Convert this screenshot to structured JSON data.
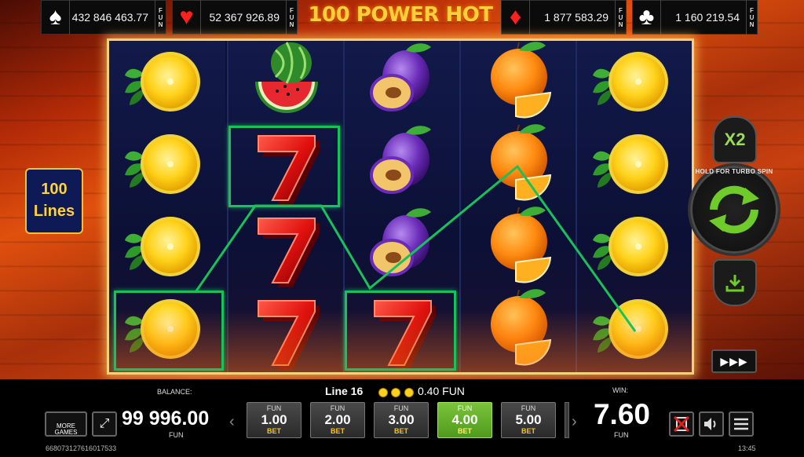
{
  "jackpots": [
    {
      "suit": "spade-icon",
      "glyph": "♠",
      "amount": "432 846 463.77",
      "fun": "FUN",
      "color": "#ffffff"
    },
    {
      "suit": "heart-icon",
      "glyph": "♥",
      "amount": "52 367 926.89",
      "fun": "FUN",
      "color": "#ff2020"
    },
    {
      "suit": "diamond-icon",
      "glyph": "♦",
      "amount": "1 877 583.29",
      "fun": "FUN",
      "color": "#ff2020"
    },
    {
      "suit": "club-icon",
      "glyph": "♣",
      "amount": "1 160 219.54",
      "fun": "FUN",
      "color": "#ffffff"
    }
  ],
  "game_title": "100 POWER HOT",
  "lines_badge": {
    "line1": "100",
    "line2": "Lines"
  },
  "reels": [
    [
      "lemon",
      "lemon",
      "lemon",
      "lemon"
    ],
    [
      "watermelon",
      "seven",
      "seven",
      "seven"
    ],
    [
      "plum",
      "plum",
      "plum",
      "seven"
    ],
    [
      "orange",
      "orange",
      "orange",
      "orange"
    ],
    [
      "lemon",
      "lemon",
      "lemon",
      "lemon"
    ]
  ],
  "controls": {
    "double_label": "X2",
    "spin_label": "HOLD FOR TURBO SPIN",
    "fast_forward": "▶▶▶"
  },
  "bottom_bar": {
    "balance_label": "BALANCE:",
    "balance_value": "99 996.00",
    "balance_currency": "FUN",
    "line_info": "Line 16",
    "line_amount": "0.40 FUN",
    "win_label": "WIN:",
    "win_value": "7.60",
    "win_currency": "FUN",
    "more_games": "MORE GAMES",
    "session_id": "668073127616017533",
    "clock": "13:45",
    "bets": [
      {
        "fun": "FUN",
        "value": "1.00",
        "label": "BET",
        "active": false
      },
      {
        "fun": "FUN",
        "value": "2.00",
        "label": "BET",
        "active": false
      },
      {
        "fun": "FUN",
        "value": "3.00",
        "label": "BET",
        "active": false
      },
      {
        "fun": "FUN",
        "value": "4.00",
        "label": "BET",
        "active": true
      },
      {
        "fun": "FUN",
        "value": "5.00",
        "label": "BET",
        "active": false
      }
    ]
  },
  "colors": {
    "accent_gold": "#ffcf3a",
    "win_line": "#18c25a",
    "active_bet": "#5aa822"
  }
}
